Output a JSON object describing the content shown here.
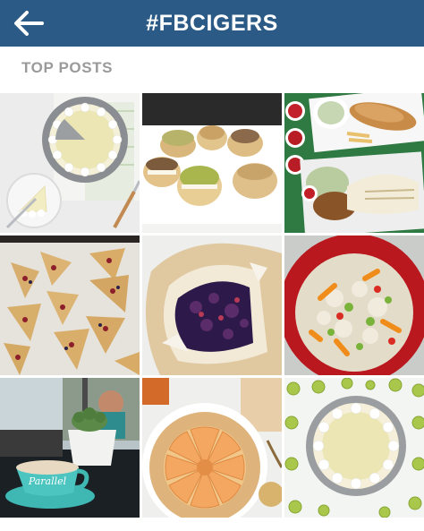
{
  "header": {
    "title": "#FBCIGERS",
    "back_icon": "back-arrow-icon",
    "background_color": "#2a5a85"
  },
  "section": {
    "label": "TOP POSTS"
  },
  "posts": [
    {
      "subject": "key lime pie with whipped cream"
    },
    {
      "subject": "cream puffs on a platter"
    },
    {
      "subject": "fish and chips with coleslaw"
    },
    {
      "subject": "berry scones on a baking sheet"
    },
    {
      "subject": "blueberry galette"
    },
    {
      "subject": "rice salad in a red bowl"
    },
    {
      "subject": "latte cup with cactus plant",
      "cup_text": "Parallel"
    },
    {
      "subject": "peach galette"
    },
    {
      "subject": "key lime pie with limes"
    }
  ]
}
